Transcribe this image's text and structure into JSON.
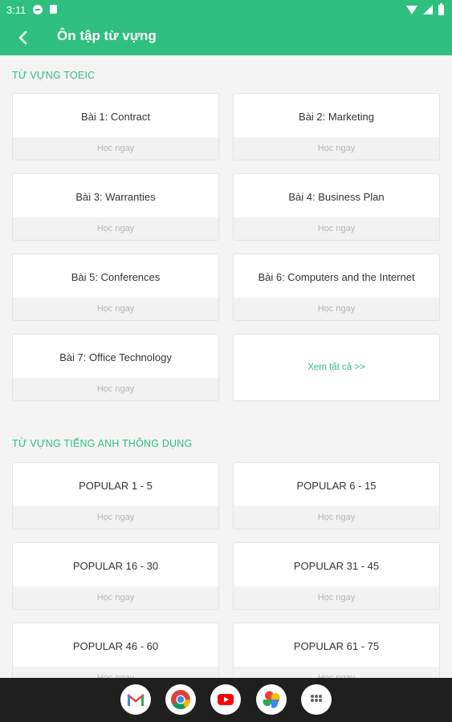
{
  "status_bar": {
    "time": "3:11"
  },
  "header": {
    "title": "Ôn tập từ vựng"
  },
  "sections": [
    {
      "title": "TỪ VỰNG TOEIC",
      "cards": [
        {
          "title": "Bài 1: Contract",
          "action": "Học ngay"
        },
        {
          "title": "Bài 2: Marketing",
          "action": "Học ngay"
        },
        {
          "title": "Bài 3: Warranties",
          "action": "Học ngay"
        },
        {
          "title": "Bài 4: Business Plan",
          "action": "Học ngay"
        },
        {
          "title": "Bài 5: Conferences",
          "action": "Học ngay"
        },
        {
          "title": "Bài 6: Computers and the Internet",
          "action": "Học ngay"
        },
        {
          "title": "Bài 7: Office Technology",
          "action": "Học ngay"
        }
      ],
      "see_all": "Xem tất cả >>"
    },
    {
      "title": "TỪ VỰNG TIẾNG ANH THÔNG DỤNG",
      "cards": [
        {
          "title": "POPULAR 1 - 5",
          "action": "Học ngay"
        },
        {
          "title": "POPULAR 6 - 15",
          "action": "Học ngay"
        },
        {
          "title": "POPULAR 16 - 30",
          "action": "Học ngay"
        },
        {
          "title": "POPULAR 31 - 45",
          "action": "Học ngay"
        },
        {
          "title": "POPULAR 46 - 60",
          "action": "Học ngay"
        },
        {
          "title": "POPULAR 61 - 75",
          "action": "Học ngay"
        }
      ]
    }
  ],
  "nav_apps": [
    "gmail-icon",
    "chrome-icon",
    "youtube-icon",
    "photos-icon",
    "app-drawer-icon"
  ],
  "colors": {
    "accent": "#2fbf7f",
    "background": "#f4f4f4",
    "nav_bar": "#1f1f1f"
  }
}
